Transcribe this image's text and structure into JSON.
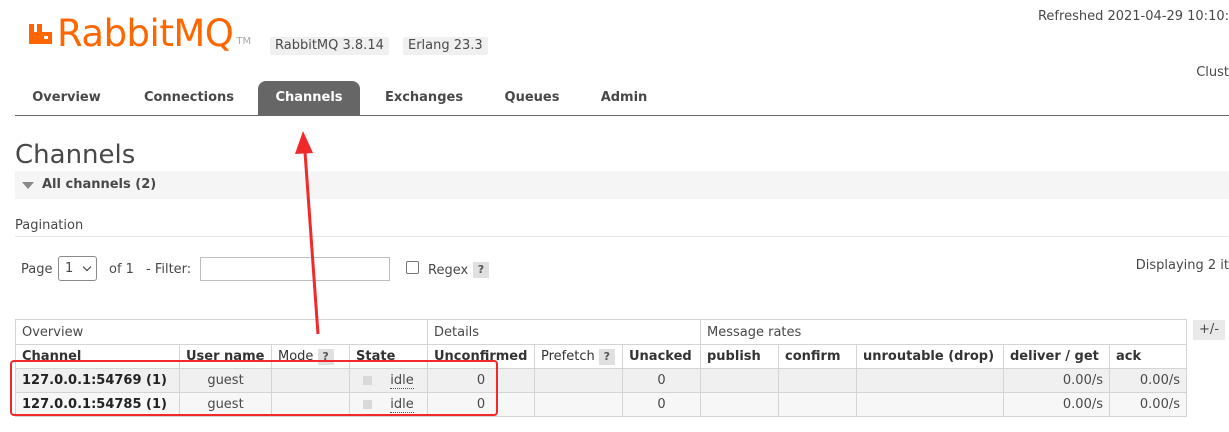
{
  "header": {
    "logo_text": "RabbitMQ",
    "logo_tm": "TM",
    "version_badge": "RabbitMQ 3.8.14",
    "erlang_badge": "Erlang 23.3",
    "refreshed": "Refreshed 2021-04-29 10:10:",
    "cluster": "Clust"
  },
  "nav": {
    "tabs": [
      {
        "label": "Overview"
      },
      {
        "label": "Connections"
      },
      {
        "label": "Channels"
      },
      {
        "label": "Exchanges"
      },
      {
        "label": "Queues"
      },
      {
        "label": "Admin"
      }
    ],
    "active": "Channels"
  },
  "page": {
    "title": "Channels",
    "section": "All channels (2)"
  },
  "pagination": {
    "label": "Pagination",
    "page_label": "Page",
    "page_value": "1",
    "of_label": "of 1",
    "filter_label": "- Filter:",
    "filter_value": "",
    "regex_label": "Regex",
    "help": "?",
    "displaying": "Displaying 2 it"
  },
  "table": {
    "groups": [
      "Overview",
      "Details",
      "Message rates"
    ],
    "columns": [
      "Channel",
      "User name",
      "Mode",
      "State",
      "Unconfirmed",
      "Prefetch",
      "Unacked",
      "publish",
      "confirm",
      "unroutable (drop)",
      "deliver / get",
      "ack"
    ],
    "rows": [
      {
        "channel": "127.0.0.1:54769 (1)",
        "user": "guest",
        "mode": "",
        "state": "idle",
        "unconfirmed": "0",
        "prefetch": "",
        "unacked": "0",
        "publish": "",
        "confirm": "",
        "unroutable": "",
        "deliver": "0.00/s",
        "ack": "0.00/s"
      },
      {
        "channel": "127.0.0.1:54785 (1)",
        "user": "guest",
        "mode": "",
        "state": "idle",
        "unconfirmed": "0",
        "prefetch": "",
        "unacked": "0",
        "publish": "",
        "confirm": "",
        "unroutable": "",
        "deliver": "0.00/s",
        "ack": "0.00/s"
      }
    ],
    "columns_toggle": "+/-"
  },
  "colors": {
    "brand": "#ff6600",
    "active_tab": "#666666",
    "annotation": "#f02a2a"
  }
}
